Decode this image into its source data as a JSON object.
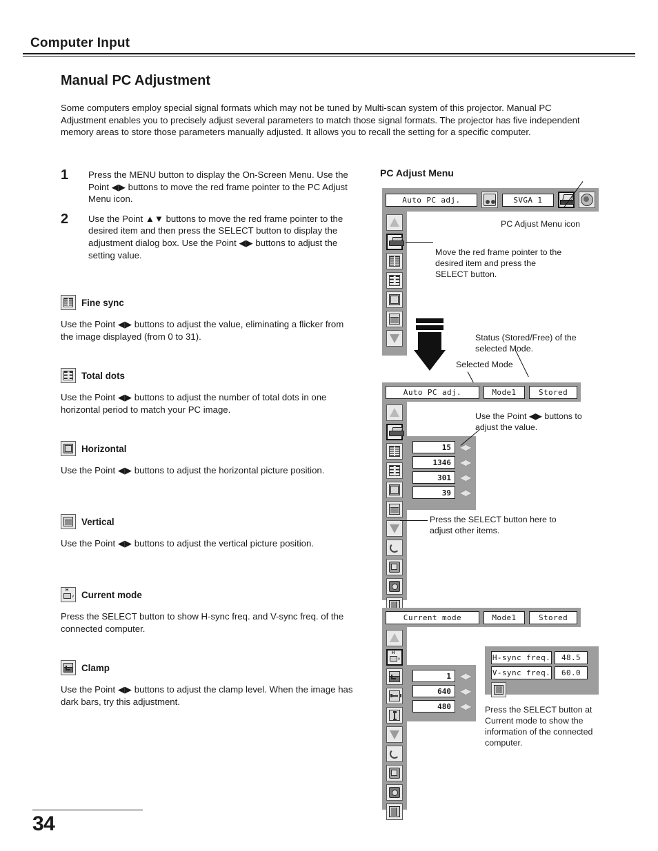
{
  "header": {
    "chapter": "Computer Input"
  },
  "footer": {
    "page_number": "34"
  },
  "title": "Manual PC Adjustment",
  "intro": "Some computers employ special signal formats which may not be tuned by Multi-scan system of this projector. Manual PC Adjustment enables you to precisely adjust several parameters to match those signal formats. The projector has five independent memory areas to store those parameters manually adjusted. It allows you to recall the setting for a specific computer.",
  "steps": [
    {
      "num": "1",
      "text": "Press the MENU button to display the On-Screen Menu. Use the Point ◀▶ buttons to move the red frame pointer to the PC Adjust Menu icon."
    },
    {
      "num": "2",
      "text": "Use the Point ▲▼ buttons to move the red frame pointer to the desired item and then press the SELECT button to display the adjustment dialog box. Use the Point ◀▶ buttons to adjust the setting value."
    }
  ],
  "sections": [
    {
      "icon": "fine-sync-icon",
      "label": "Fine sync",
      "text": "Use the Point ◀▶ buttons to adjust the value, eliminating a flicker from the image displayed (from 0 to 31)."
    },
    {
      "icon": "total-dots-icon",
      "label": "Total dots",
      "text": "Use the Point ◀▶ buttons to adjust the number of total dots in one horizontal period to match your PC image."
    },
    {
      "icon": "horizontal-icon",
      "label": "Horizontal",
      "text": "Use the Point ◀▶ buttons to adjust the horizontal picture position."
    },
    {
      "icon": "vertical-icon",
      "label": "Vertical",
      "text": "Use the Point ◀▶ buttons to adjust the vertical picture position."
    },
    {
      "icon": "current-mode-icon",
      "label": "Current mode",
      "text": "Press the SELECT button to show H-sync freq. and V-sync freq. of the connected computer."
    },
    {
      "icon": "clamp-icon",
      "label": "Clamp",
      "text": "Use the Point ◀▶ buttons to adjust the clamp level. When the image has dark bars, try this adjustment."
    }
  ],
  "diagram": {
    "title": "PC Adjust Menu",
    "menubar": {
      "auto_pc_adj": "Auto PC adj.",
      "system": "SVGA 1",
      "icons": [
        "sound-icon",
        "pc-adjust-menu-icon",
        "image-select-icon"
      ]
    },
    "panel1": {
      "icons": [
        "up-arrow-icon",
        "pc-adjust-icon",
        "fine-sync-icon",
        "total-dots-icon",
        "horizontal-icon",
        "vertical-icon",
        "down-arrow-icon"
      ],
      "selected_index": 1
    },
    "panel2": {
      "header": {
        "title": "Auto PC adj.",
        "mode": "Mode1",
        "status": "Stored"
      },
      "icons": [
        "up-arrow-icon",
        "pc-adjust-icon",
        "fine-sync-icon",
        "total-dots-icon",
        "horizontal-icon",
        "vertical-icon",
        "down-arrow-icon",
        "reset-icon",
        "store-icon",
        "mode-free-icon",
        "quit-icon"
      ],
      "selected_index": 1,
      "values": [
        "15",
        "1346",
        "301",
        "39"
      ]
    },
    "panel3": {
      "header": {
        "title": "Current mode",
        "mode": "Mode1",
        "status": "Stored"
      },
      "icons": [
        "up-arrow-icon",
        "current-mode-icon",
        "clamp-icon",
        "display-area-h-icon",
        "display-area-v-icon",
        "down-arrow-icon",
        "reset-icon",
        "store-icon",
        "mode-free-icon",
        "quit-icon"
      ],
      "selected_index": 1,
      "values": [
        "1",
        "640",
        "480"
      ],
      "info": {
        "rows": [
          {
            "label": "H-sync freq.",
            "value": "48.5"
          },
          {
            "label": "V-sync freq.",
            "value": "60.0"
          }
        ],
        "quit_icon": "quit-icon"
      }
    },
    "callouts": {
      "menu_icon": "PC Adjust Menu icon",
      "move_pointer": "Move the red frame pointer to the desired item and press the SELECT button.",
      "status": "Status (Stored/Free) of the selected Mode.",
      "selected_mode": "Selected Mode",
      "adjust_value": "Use the Point ◀▶ buttons to adjust the value.",
      "select_other": "Press the SELECT button here to adjust other items.",
      "current_mode_info": "Press the SELECT button at Current mode to show the information of the connected computer."
    }
  }
}
